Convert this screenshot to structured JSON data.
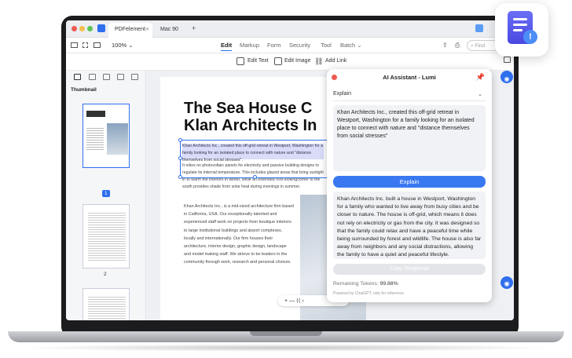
{
  "tabs": {
    "app_name": "PDFelement",
    "doc_name": "Mac 90",
    "new_tab": "+"
  },
  "toolbar": {
    "zoom": "100%",
    "menu": [
      "Edit",
      "Markup",
      "Form",
      "Security",
      "Tool",
      "Batch"
    ],
    "batch_caret": "⌄",
    "search_placeholder": "Find"
  },
  "subbar": {
    "edit_text": "Edit Text",
    "edit_image": "Edit Image",
    "add_link": "Add Link"
  },
  "left_panel": {
    "label": "Thumbnail",
    "pages": [
      "1",
      "2"
    ]
  },
  "document": {
    "title_line1": "The Sea House C",
    "title_line2": "Klan Architects In",
    "selected_text": "Khan Architects Inc., created this off-grid retreat in Westport, Washington for a family looking for an isolated place to connect with nature and \"distance themselves from social stresses\".",
    "para2": "It relies on photovoltaic panels for electricity and passive building designs to regulate its internal temperature. This includes glazed areas that bring sunlight in to warm the interiors in winter, while an extended roof-lookingcorner to the south provides shade from solar heat during evenings in summer.",
    "body": "Khan Architects Inc., is a mid-sized architecture firm based in California, USA. Our exceptionally talented and experienced staff work on projects from boutique interiors to large institutional buildings and airport complexes, locally and internationally. Our firm houses their architecture, interior design, graphic design, landscape and model making staff. We strieve to be leaders in the community through work, research and personal choices.",
    "zoom_controls": "+  —  ⟨⟨  ‹"
  },
  "ai_panel": {
    "title": "AI Assistant - Lumi",
    "mode": "Explain",
    "input_text": "Khan Architects Inc., created this off-grid retreat in Westport, Washington for a family looking for an isolated place to connect with nature and \"distance themselves from social stresses\"",
    "explain_button": "Explain",
    "output_text": "Khan Architects Inc. built a house in Westport, Washington for a family who wanted to live away from busy cities and be closer to nature. The house is off-grid, which means it does not rely on electricity or gas from the city. It was designed so that the family could relax and have a peaceful time while being surrounded by forest and wildlife. The house is also far away from neighbors and any social distractions, allowing the family to have a quiet and peaceful lifestyle.",
    "copy_button": "Copy Response",
    "tokens_label": "Remaining Tokens:",
    "tokens_value": "99.88%",
    "powered": "Powered by ChatGPT, only for reference"
  },
  "colors": {
    "accent": "#2f6fed",
    "close": "#ee5a52",
    "float_icon": "#5a5cf0"
  }
}
